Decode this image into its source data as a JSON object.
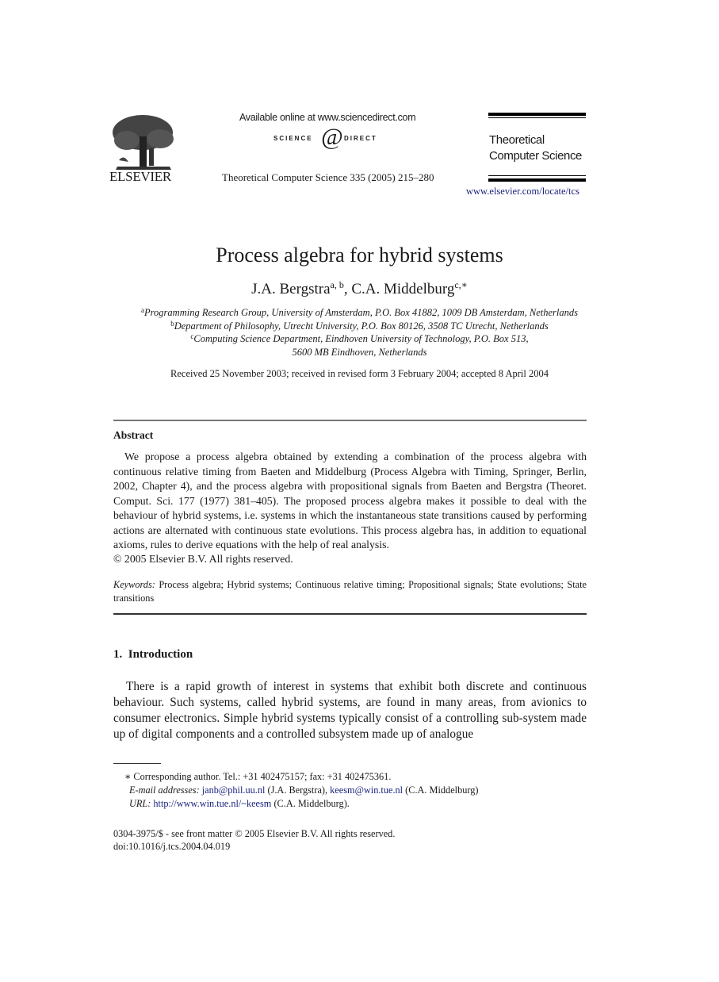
{
  "header": {
    "publisher": "ELSEVIER",
    "available_online": "Available online at www.sciencedirect.com",
    "sciencedirect_left": "SCIENCE",
    "sciencedirect_right": "DIRECT",
    "journal_reference": "Theoretical Computer Science 335 (2005) 215–280",
    "journal_name_line1": "Theoretical",
    "journal_name_line2": "Computer Science",
    "journal_url": "www.elsevier.com/locate/tcs"
  },
  "paper": {
    "title": "Process algebra for hybrid systems",
    "authors": [
      {
        "name": "J.A. Bergstra",
        "affil": "a, b",
        "sep": ", "
      },
      {
        "name": "C.A. Middelburg",
        "affil": "c,∗",
        "sep": ""
      }
    ],
    "affiliations": [
      {
        "mark": "a",
        "text": "Programming Research Group, University of Amsterdam, P.O. Box 41882, 1009 DB Amsterdam, Netherlands"
      },
      {
        "mark": "b",
        "text": "Department of Philosophy, Utrecht University, P.O. Box 80126, 3508 TC Utrecht, Netherlands"
      },
      {
        "mark": "c",
        "text": "Computing Science Department, Eindhoven University of Technology, P.O. Box 513,"
      },
      {
        "mark": "",
        "text": "5600 MB Eindhoven, Netherlands"
      }
    ],
    "received": "Received 25 November 2003; received in revised form 3 February 2004; accepted 8 April 2004"
  },
  "abstract": {
    "heading": "Abstract",
    "text": "We propose a process algebra obtained by extending a combination of the process algebra with continuous relative timing from Baeten and Middelburg (Process Algebra with Timing, Springer, Berlin, 2002, Chapter 4), and the process algebra with propositional signals from Baeten and Bergstra (Theoret. Comput. Sci. 177 (1977) 381–405). The proposed process algebra makes it possible to deal with the behaviour of hybrid systems, i.e. systems in which the instantaneous state transitions caused by performing actions are alternated with continuous state evolutions. This process algebra has, in addition to equational axioms, rules to derive equations with the help of real analysis.",
    "copyright": "© 2005 Elsevier B.V. All rights reserved.",
    "keywords_label": "Keywords:",
    "keywords": "Process algebra; Hybrid systems; Continuous relative timing; Propositional signals; State evolutions; State transitions"
  },
  "introduction": {
    "heading": "1.  Introduction",
    "text": "There is a rapid growth of interest in systems that exhibit both discrete and continuous behaviour. Such systems, called hybrid systems, are found in many areas, from avionics to consumer electronics. Simple hybrid systems typically consist of a controlling sub-system made up of digital components and a controlled subsystem made up of analogue"
  },
  "footnotes": {
    "corresponding": "∗ Corresponding author. Tel.: +31 402475157; fax: +31 402475361.",
    "email_label": "E-mail addresses:",
    "email1": "janb@phil.uu.nl",
    "email1_owner": " (J.A. Bergstra), ",
    "email2": "keesm@win.tue.nl",
    "email2_owner": " (C.A. Middelburg)",
    "url_label": "URL:",
    "url": "http://www.win.tue.nl/~keesm",
    "url_owner": " (C.A. Middelburg)."
  },
  "bottom": {
    "issn": "0304-3975/$ - see front matter © 2005 Elsevier B.V. All rights reserved.",
    "doi": "doi:10.1016/j.tcs.2004.04.019"
  }
}
